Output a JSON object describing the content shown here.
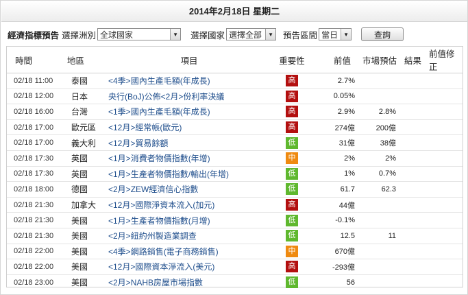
{
  "header": {
    "date": "2014年2月18日 星期二"
  },
  "filters": {
    "title": "經濟指標預告",
    "continent_label": "選擇洲別",
    "continent_value": "全球國家",
    "country_label": "選擇國家",
    "country_value": "選擇全部",
    "period_label": "預告區間",
    "period_value": "當日",
    "query_label": "查詢"
  },
  "table": {
    "columns": [
      "時間",
      "地區",
      "項目",
      "重要性",
      "前值",
      "市場預估",
      "結果",
      "前值修正"
    ],
    "rows": [
      {
        "time": "02/18 11:00",
        "region": "泰國",
        "item": "<4季>國內生產毛額(年成長)",
        "importance": "高",
        "previous": "2.7%",
        "forecast": "",
        "result": "",
        "revised": ""
      },
      {
        "time": "02/18 12:00",
        "region": "日本",
        "item": "央行(BoJ)公佈<2月>份利率決議",
        "importance": "高",
        "previous": "0.05%",
        "forecast": "",
        "result": "",
        "revised": ""
      },
      {
        "time": "02/18 16:00",
        "region": "台灣",
        "item": "<1季>國內生產毛額(年成長)",
        "importance": "高",
        "previous": "2.9%",
        "forecast": "2.8%",
        "result": "",
        "revised": ""
      },
      {
        "time": "02/18 17:00",
        "region": "歐元區",
        "item": "<12月>經常帳(歐元)",
        "importance": "高",
        "previous": "274億",
        "forecast": "200億",
        "result": "",
        "revised": ""
      },
      {
        "time": "02/18 17:00",
        "region": "義大利",
        "item": "<12月>貿易餘額",
        "importance": "低",
        "previous": "31億",
        "forecast": "38億",
        "result": "",
        "revised": ""
      },
      {
        "time": "02/18 17:30",
        "region": "英國",
        "item": "<1月>消費者物價指數(年增)",
        "importance": "中",
        "previous": "2%",
        "forecast": "2%",
        "result": "",
        "revised": ""
      },
      {
        "time": "02/18 17:30",
        "region": "英國",
        "item": "<1月>生產者物價指數/輸出(年增)",
        "importance": "低",
        "previous": "1%",
        "forecast": "0.7%",
        "result": "",
        "revised": ""
      },
      {
        "time": "02/18 18:00",
        "region": "德國",
        "item": "<2月>ZEW經濟信心指數",
        "importance": "低",
        "previous": "61.7",
        "forecast": "62.3",
        "result": "",
        "revised": ""
      },
      {
        "time": "02/18 21:30",
        "region": "加拿大",
        "item": "<12月>國際淨資本流入(加元)",
        "importance": "高",
        "previous": "44億",
        "forecast": "",
        "result": "",
        "revised": ""
      },
      {
        "time": "02/18 21:30",
        "region": "美國",
        "item": "<1月>生產者物價指數(月增)",
        "importance": "低",
        "previous": "-0.1%",
        "forecast": "",
        "result": "",
        "revised": ""
      },
      {
        "time": "02/18 21:30",
        "region": "美國",
        "item": "<2月>紐約州製造業調查",
        "importance": "低",
        "previous": "12.5",
        "forecast": "11",
        "result": "",
        "revised": ""
      },
      {
        "time": "02/18 22:00",
        "region": "美國",
        "item": "<4季>網路銷售(電子商務銷售)",
        "importance": "中",
        "previous": "670億",
        "forecast": "",
        "result": "",
        "revised": ""
      },
      {
        "time": "02/18 22:00",
        "region": "美國",
        "item": "<12月>國際資本淨流入(美元)",
        "importance": "高",
        "previous": "-293億",
        "forecast": "",
        "result": "",
        "revised": ""
      },
      {
        "time": "02/18 23:00",
        "region": "美國",
        "item": "<2月>NAHB房屋市場指數",
        "importance": "低",
        "previous": "56",
        "forecast": "",
        "result": "",
        "revised": ""
      }
    ]
  },
  "importance_colors": {
    "高": "#b30f0f",
    "中": "#ef8a10",
    "低": "#5fb82e"
  }
}
